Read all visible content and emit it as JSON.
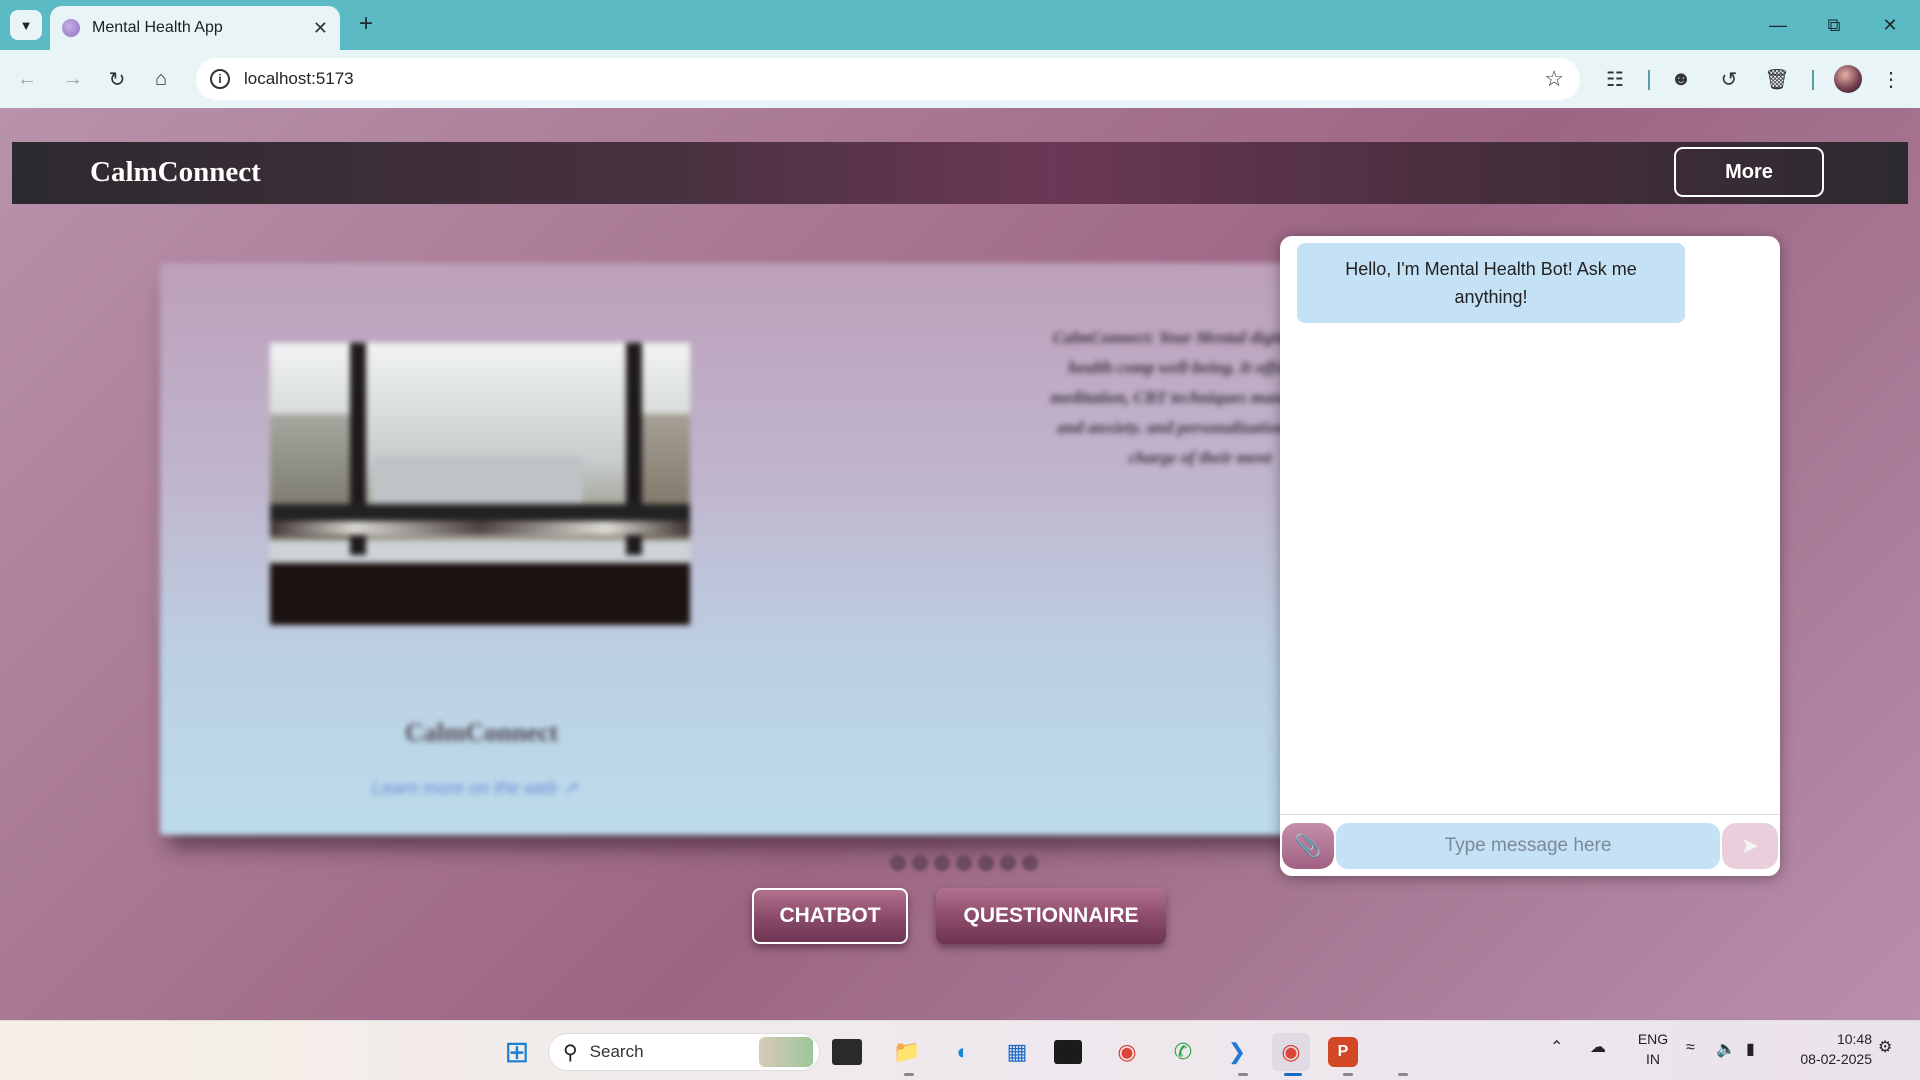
{
  "browser": {
    "tab_title": "Mental Health App",
    "url": "localhost:5173"
  },
  "app": {
    "brand": "CalmConnect",
    "more_label": "More"
  },
  "hero": {
    "title": "CalmConnect",
    "link_text": "Learn more on the web",
    "description": "CalmConnect: Your Mental digital mental health comp well-being. It offers AI-p meditation, CBT techniques manage stress and anxiety. and personalization, CalmC charge of their ment"
  },
  "carousel": {
    "dot_count": 7
  },
  "buttons": {
    "chatbot": "CHATBOT",
    "questionnaire": "QUESTIONNAIRE"
  },
  "chat": {
    "greeting": "Hello, I'm Mental Health Bot! Ask me anything!",
    "input_placeholder": "Type message here"
  },
  "taskbar": {
    "search_label": "Search",
    "lang_line1": "ENG",
    "lang_line2": "IN",
    "time": "10:48",
    "date": "08-02-2025"
  },
  "colors": {
    "tabbar": "#5cbac4",
    "chat_bubble": "#c5e1f5",
    "button_accent": "#8d4c6b"
  }
}
